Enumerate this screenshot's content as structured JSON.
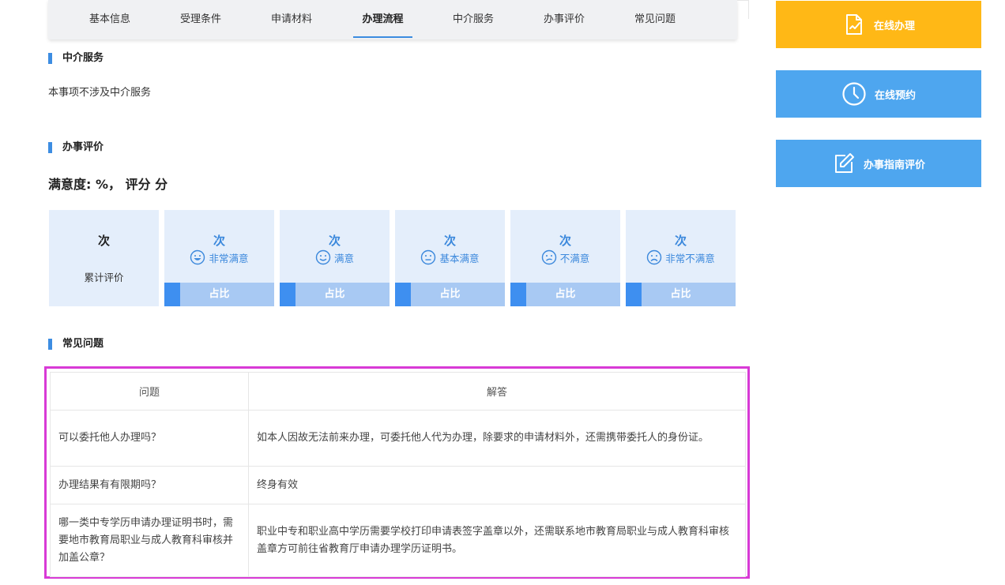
{
  "tabs": [
    {
      "label": "基本信息",
      "active": false
    },
    {
      "label": "受理条件",
      "active": false
    },
    {
      "label": "申请材料",
      "active": false
    },
    {
      "label": "办理流程",
      "active": true
    },
    {
      "label": "中介服务",
      "active": false
    },
    {
      "label": "办事评价",
      "active": false
    },
    {
      "label": "常见问题",
      "active": false
    }
  ],
  "intermediary": {
    "title": "中介服务",
    "text": "本事项不涉及中介服务"
  },
  "evaluation": {
    "title": "办事评价",
    "satisfaction": "满意度: %， 评分 分",
    "total": {
      "count": "次",
      "label": "累计评价"
    },
    "cards": [
      {
        "count": "次",
        "label": "非常满意",
        "icon": "very-satisfied-face-icon",
        "ratio": "占比"
      },
      {
        "count": "次",
        "label": "满意",
        "icon": "satisfied-face-icon",
        "ratio": "占比"
      },
      {
        "count": "次",
        "label": "基本满意",
        "icon": "neutral-face-icon",
        "ratio": "占比"
      },
      {
        "count": "次",
        "label": "不满意",
        "icon": "dissatisfied-face-icon",
        "ratio": "占比"
      },
      {
        "count": "次",
        "label": "非常不满意",
        "icon": "very-dissatisfied-face-icon",
        "ratio": "占比"
      }
    ]
  },
  "faq": {
    "title": "常见问题",
    "header": {
      "question": "问题",
      "answer": "解答"
    },
    "rows": [
      {
        "question": "可以委托他人办理吗？",
        "answer": "如本人因故无法前来办理，可委托他人代为办理，除要求的申请材料外，还需携带委托人的身份证。"
      },
      {
        "question": "办理结果有有限期吗？",
        "answer": "终身有效"
      },
      {
        "question": "哪一类中专学历申请办理证明书时，需要地市教育局职业与成人教育科审核并加盖公章？",
        "answer": "职业中专和职业高中学历需要学校打印申请表签字盖章以外，还需联系地市教育局职业与成人教育科审核盖章方可前往省教育厅申请办理学历证明书。"
      }
    ]
  },
  "side": {
    "online_handle": {
      "label": "在线办理",
      "icon": "document-sign-icon",
      "color": "#ffb816"
    },
    "online_appointment": {
      "label": "在线预约",
      "icon": "clock-icon",
      "color": "#4ea6ef"
    },
    "guide_evaluation": {
      "label": "办事指南评价",
      "icon": "edit-icon",
      "color": "#4ea6ef"
    }
  },
  "colors": {
    "accent": "#3d8de2",
    "card_bg": "#e4eefb",
    "ratio_bar": "#a8c9f3",
    "ratio_fill": "#3e8ff0",
    "highlight_border": "#d83ad6"
  }
}
